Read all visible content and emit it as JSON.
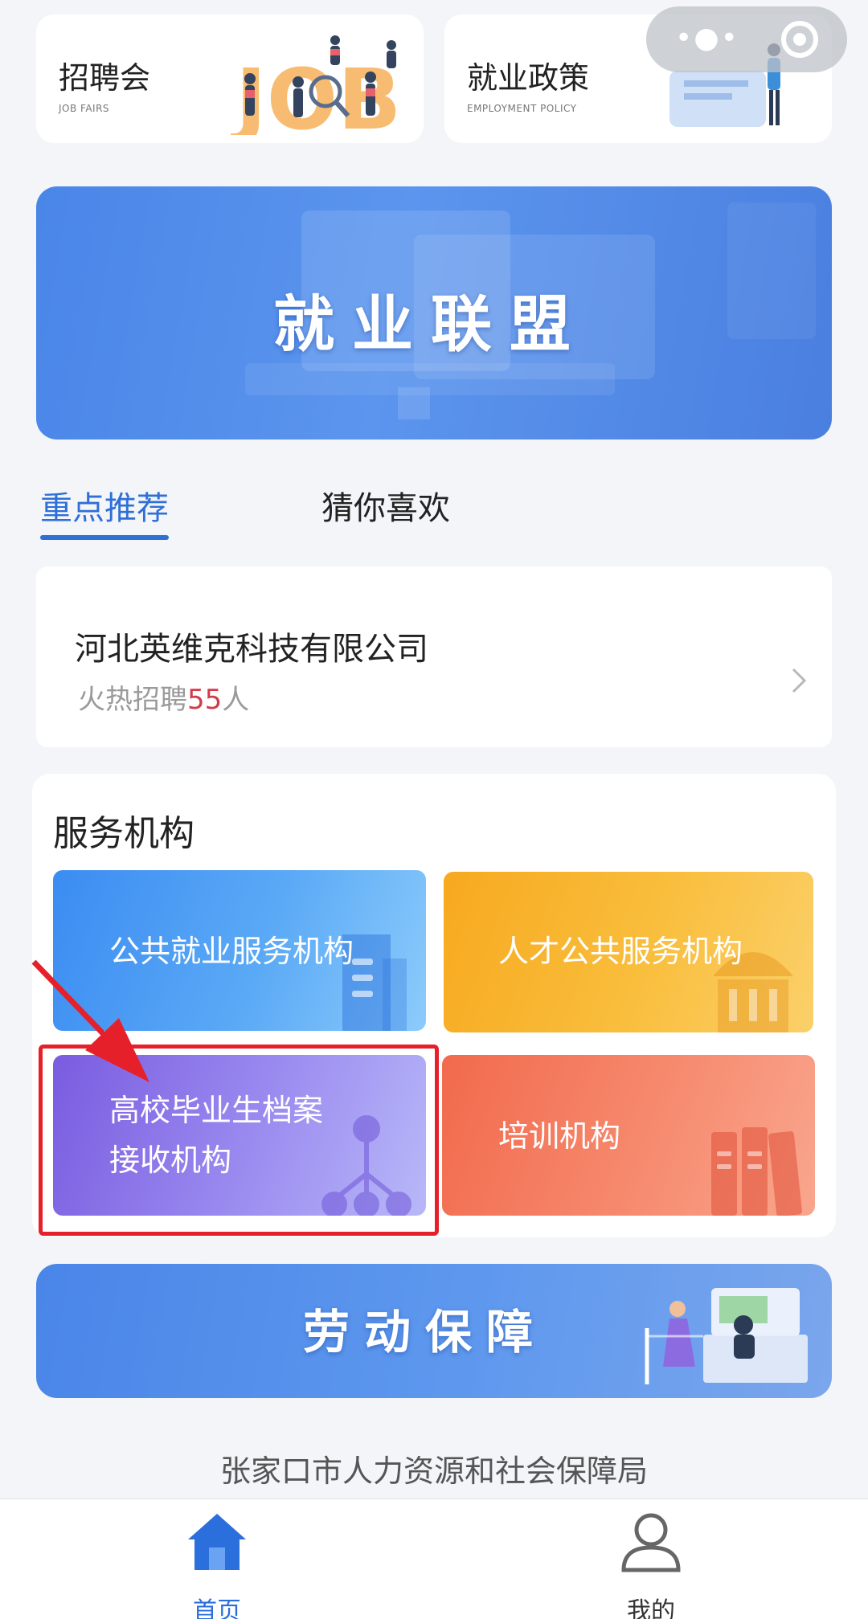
{
  "top_cards": [
    {
      "title": "招聘会",
      "subtitle": "JOB FAIRS",
      "art_text": "JOB"
    },
    {
      "title": "就业政策",
      "subtitle": "EMPLOYMENT POLICY"
    }
  ],
  "banner_alliance": {
    "text": "就业联盟"
  },
  "tabs": [
    {
      "label": "重点推荐",
      "active": true
    },
    {
      "label": "猜你喜欢",
      "active": false
    }
  ],
  "company": {
    "name": "河北英维克科技有限公司",
    "hire_prefix": "火热招聘",
    "hire_count": "55",
    "hire_suffix": "人"
  },
  "services": {
    "title": "服务机构",
    "items": [
      {
        "line1": "公共就业服务机构",
        "line2": ""
      },
      {
        "line1": "人才公共服务机构",
        "line2": ""
      },
      {
        "line1": "高校毕业生档案",
        "line2": "接收机构"
      },
      {
        "line1": "培训机构",
        "line2": ""
      }
    ]
  },
  "banner_labor": {
    "text": "劳动保障"
  },
  "footer": {
    "text": "张家口市人力资源和社会保障局"
  },
  "tabbar": [
    {
      "label": "首页",
      "icon": "home-icon",
      "active": true
    },
    {
      "label": "我的",
      "icon": "user-icon",
      "active": false
    }
  ],
  "colors": {
    "accent": "#2f6fd6",
    "highlight_red": "#e6202a",
    "count_red": "#d23b4a"
  }
}
